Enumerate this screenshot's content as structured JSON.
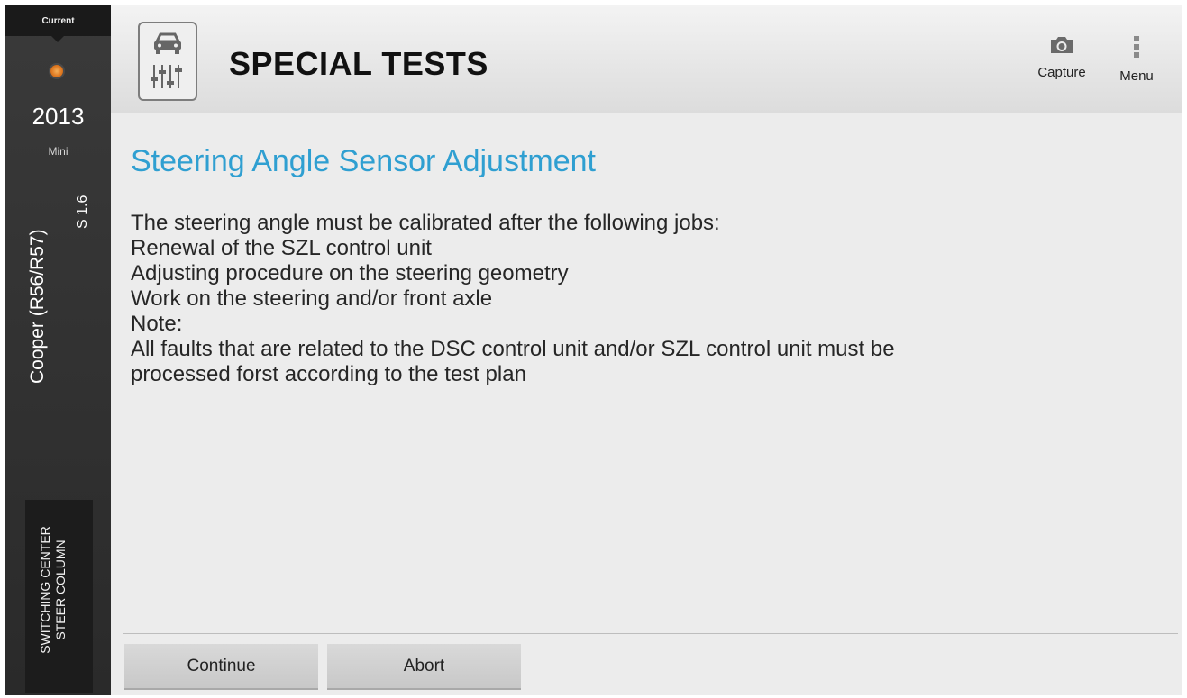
{
  "sidebar": {
    "current_label": "Current",
    "year": "2013",
    "make": "Mini",
    "model": "Cooper (R56/R57)",
    "engine": "S 1.6",
    "module_line1": "Switching Center",
    "module_line2": "Steer Column",
    "status_color": "#e07a22"
  },
  "header": {
    "title": "SPECIAL TESTS",
    "app_icon": "car-diagnostics-icon",
    "capture_label": "Capture",
    "capture_icon": "camera-icon",
    "menu_label": "Menu",
    "menu_icon": "vertical-dots-icon"
  },
  "content": {
    "title": "Steering Angle Sensor Adjustment",
    "title_color": "#2f9fd1",
    "lines": [
      "The steering angle must be calibrated after the following jobs:",
      "Renewal of the SZL control unit",
      "Adjusting procedure on the steering geometry",
      "Work on the steering and/or front axle",
      "Note:",
      "All faults that are related to the DSC control unit and/or SZL control unit must be",
      "processed forst according to the test plan"
    ]
  },
  "footer": {
    "continue_label": "Continue",
    "abort_label": "Abort"
  }
}
